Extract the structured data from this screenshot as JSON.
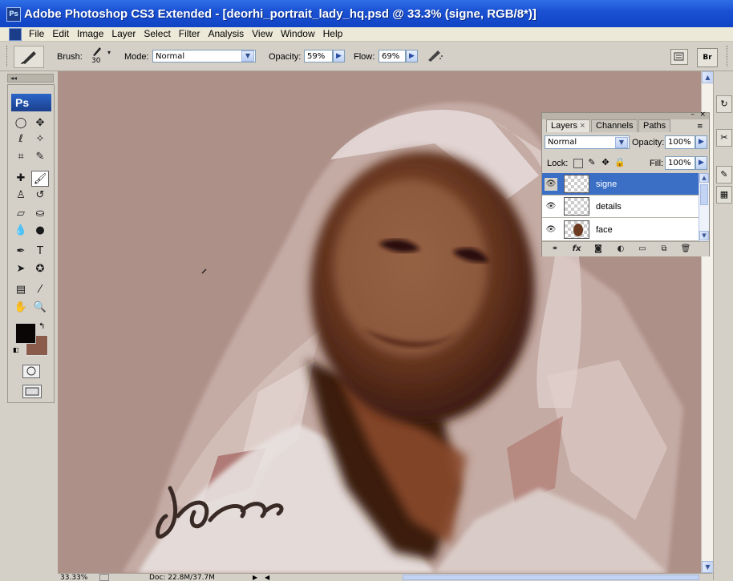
{
  "window": {
    "title": "Adobe Photoshop CS3 Extended - [deorhi_portrait_lady_hq.psd @ 33.3% (signe, RGB/8*)]",
    "icon_label": "Ps"
  },
  "menu": {
    "items": [
      "File",
      "Edit",
      "Image",
      "Layer",
      "Select",
      "Filter",
      "Analysis",
      "View",
      "Window",
      "Help"
    ]
  },
  "options": {
    "brush_label": "Brush:",
    "brush_size": "30",
    "mode_label": "Mode:",
    "mode_value": "Normal",
    "opacity_label": "Opacity:",
    "opacity_value": "59%",
    "flow_label": "Flow:",
    "flow_value": "69%",
    "bridge_label": "Br"
  },
  "toolbox": {
    "logo": "Ps",
    "collapse_glyph": "◂◂",
    "foreground_color": "#0a0606",
    "background_color": "#8a5a4a",
    "tools": [
      "marquee-icon",
      "move-icon",
      "lasso-icon",
      "magic-wand-icon",
      "crop-icon",
      "slice-icon",
      "healing-brush-icon",
      "brush-icon",
      "clone-stamp-icon",
      "history-brush-icon",
      "eraser-icon",
      "paint-bucket-icon",
      "blur-icon",
      "dodge-icon",
      "pen-icon",
      "type-icon",
      "path-selection-icon",
      "shape-icon",
      "notes-icon",
      "eyedropper-icon",
      "hand-icon",
      "zoom-icon"
    ]
  },
  "layers_panel": {
    "tabs": [
      "Layers",
      "Channels",
      "Paths"
    ],
    "blend_mode": "Normal",
    "opacity_label": "Opacity:",
    "opacity_value": "100%",
    "lock_label": "Lock:",
    "fill_label": "Fill:",
    "fill_value": "100%",
    "layers": [
      {
        "name": "signe",
        "selected": true,
        "visible": true
      },
      {
        "name": "details",
        "selected": false,
        "visible": true
      },
      {
        "name": "face",
        "selected": false,
        "visible": true
      }
    ],
    "bottom_icons": [
      "link-icon",
      "fx-icon",
      "mask-icon",
      "adjustment-icon",
      "group-icon",
      "new-layer-icon",
      "trash-icon"
    ],
    "fx_label": "fx"
  },
  "status": {
    "zoom": "33.33%",
    "doc_info": "Doc: 22.8M/37.7M"
  },
  "colors": {
    "canvas_bg": "#ad9088",
    "selection_blue": "#3b6fc6"
  }
}
